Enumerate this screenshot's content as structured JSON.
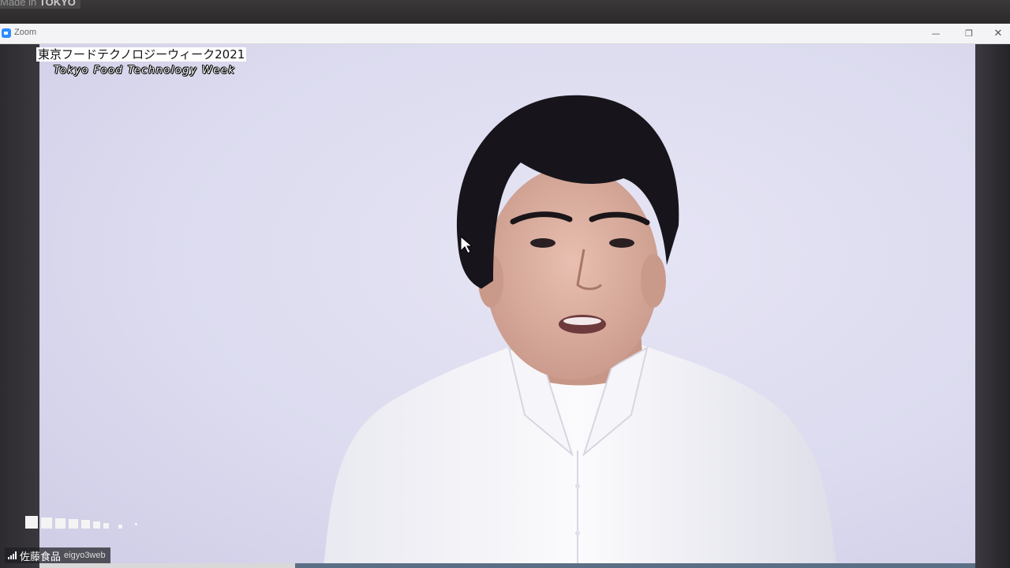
{
  "monitor": {
    "brand_prefix": "Made in",
    "brand_name": "TOKYO"
  },
  "window": {
    "app_name": "Zoom",
    "controls": {
      "minimize": "—",
      "maximize": "❐",
      "close": "✕"
    }
  },
  "overlay": {
    "event_title": "東京フードテクノロジーウィーク2021",
    "event_subtitle": "Tokyo Food Technology Week"
  },
  "participant": {
    "display_name": "佐藤食品",
    "user_id": "eigyo3web"
  },
  "colors": {
    "video_background": "#dcdbef",
    "shirt": "#f4f4f8",
    "hair": "#15131a",
    "zoom_blue": "#2d8cff"
  }
}
